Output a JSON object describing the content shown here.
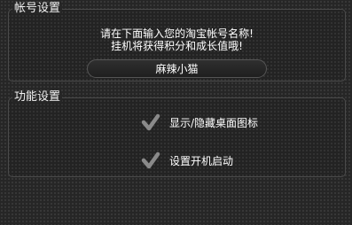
{
  "account_section": {
    "title": "帐号设置",
    "prompt_line1": "请在下面输入您的淘宝帐号名称!",
    "prompt_line2": "挂机将获得积分和成长值哦!",
    "account_value": "麻辣小猫"
  },
  "function_section": {
    "title": "功能设置",
    "options": [
      {
        "label": "显示/隐藏桌面图标",
        "checked": true
      },
      {
        "label": "设置开机启动",
        "checked": true
      }
    ]
  },
  "colors": {
    "background": "#262626",
    "border": "#4a4a4a",
    "check": "#8a8a8a",
    "text": "#ffffff"
  }
}
